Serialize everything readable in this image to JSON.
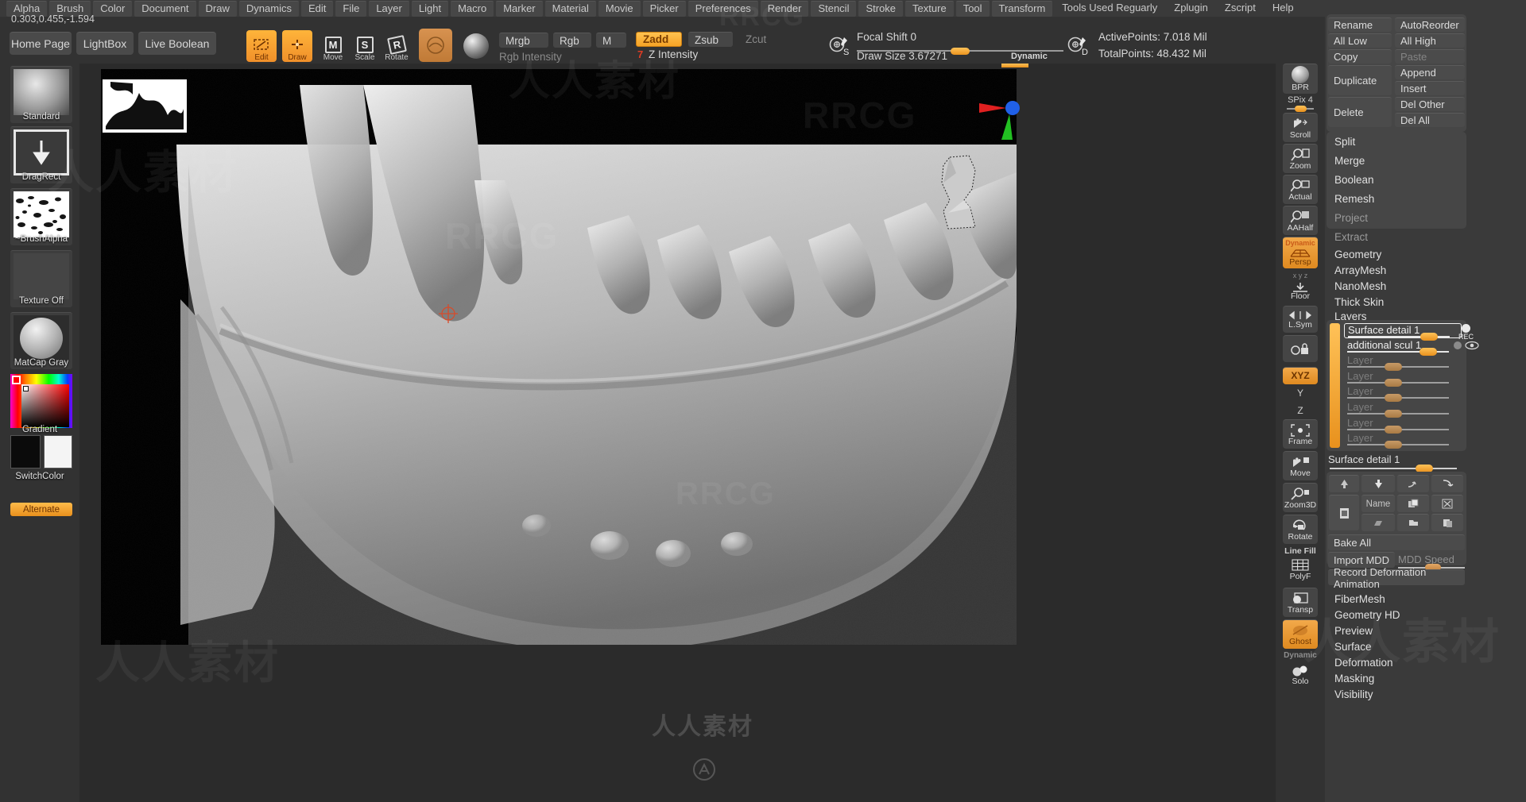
{
  "menu": {
    "items": [
      "Alpha",
      "Brush",
      "Color",
      "Document",
      "Draw",
      "Dynamics",
      "Edit",
      "File",
      "Layer",
      "Light",
      "Macro",
      "Marker",
      "Material",
      "Movie",
      "Picker",
      "Preferences",
      "Render",
      "Stencil",
      "Stroke",
      "Texture",
      "Tool",
      "Transform",
      "Tools Used Reguarly",
      "Zplugin",
      "Zscript",
      "Help"
    ]
  },
  "coord": "0.303,0.455,-1.594",
  "toolbar": {
    "home_page": "Home Page",
    "lightbox": "LightBox",
    "live_boolean": "Live Boolean",
    "edit": "Edit",
    "draw": "Draw",
    "move": "Move",
    "scale": "Scale",
    "rotate": "Rotate",
    "mrgb": "Mrgb",
    "rgb": "Rgb",
    "m": "M",
    "rgb_intensity": "Rgb Intensity",
    "zadd": "Zadd",
    "zsub": "Zsub",
    "zcut": "Zcut",
    "z_intensity": "Z Intensity",
    "z_intensity_value": "7",
    "focal_shift": "Focal Shift 0",
    "draw_size": "Draw Size 3.67271",
    "dynamic": "Dynamic",
    "active_points": "ActivePoints: 7.018 Mil",
    "total_points": "TotalPoints: 48.432 Mil",
    "s_badge": "S",
    "d_badge": "D"
  },
  "left_palette": {
    "brush": "Standard",
    "stroke": "DragRect",
    "alpha": "~BrushAlpha",
    "texture": "Texture Off",
    "material": "MatCap Gray",
    "gradient": "Gradient",
    "switch_color": "SwitchColor",
    "alternate": "Alternate"
  },
  "rail": {
    "bpr": "BPR",
    "spix": "SPix 4",
    "scroll": "Scroll",
    "zoom": "Zoom",
    "actual": "Actual",
    "aahalf": "AAHalf",
    "persp": "Persp",
    "persp_top": "Dynamic",
    "floor": "Floor",
    "lsym": "L.Sym",
    "local": "Local",
    "xyz": "XYZ",
    "y_axis": "Y",
    "z_axis": "Z",
    "frame": "Frame",
    "move": "Move",
    "zoom3d": "Zoom3D",
    "rotate": "Rotate",
    "line_fill": "Line Fill",
    "polyf": "PolyF",
    "transp": "Transp",
    "ghost": "Ghost",
    "dynamic": "Dynamic",
    "solo": "Solo"
  },
  "tool_panel": {
    "subtool_buttons": [
      {
        "label": "Rename",
        "disabled": false
      },
      {
        "label": "AutoReorder",
        "disabled": false
      },
      {
        "label": "All Low",
        "disabled": false
      },
      {
        "label": "All High",
        "disabled": false
      },
      {
        "label": "Copy",
        "disabled": false
      },
      {
        "label": "Paste",
        "disabled": true
      },
      {
        "label": "Duplicate",
        "disabled": false
      },
      {
        "label": "Append",
        "disabled": false
      },
      {
        "label": "Insert",
        "disabled": false
      },
      {
        "label": "Delete",
        "disabled": false
      },
      {
        "label": "Del Other",
        "disabled": false
      },
      {
        "label": "Del All",
        "disabled": false
      }
    ],
    "split": "Split",
    "merge": "Merge",
    "boolean": "Boolean",
    "remesh": "Remesh",
    "project": "Project",
    "extract": "Extract",
    "sections": [
      "Geometry",
      "ArrayMesh",
      "NanoMesh",
      "Thick Skin"
    ],
    "layers_title": "Layers",
    "layers": [
      {
        "name": "Surface detail",
        "num": "1",
        "intensity": 0.8,
        "active": true,
        "rec": "REC"
      },
      {
        "name": "additional scul",
        "num": "1",
        "intensity": 0.8,
        "active": false,
        "rec": ""
      },
      {
        "name": "Layer",
        "num": "",
        "intensity": 0.45,
        "active": false,
        "rec": ""
      },
      {
        "name": "Layer",
        "num": "",
        "intensity": 0.45,
        "active": false,
        "rec": ""
      },
      {
        "name": "Layer",
        "num": "",
        "intensity": 0.45,
        "active": false,
        "rec": ""
      },
      {
        "name": "Layer",
        "num": "",
        "intensity": 0.45,
        "active": false,
        "rec": ""
      },
      {
        "name": "Layer",
        "num": "",
        "intensity": 0.45,
        "active": false,
        "rec": ""
      },
      {
        "name": "Layer",
        "num": "",
        "intensity": 0.45,
        "active": false,
        "rec": ""
      }
    ],
    "selected_layer": "Surface detail 1",
    "name_button": "Name",
    "bake_all": "Bake All",
    "import_mdd": "Import MDD",
    "mdd_speed": "MDD Speed",
    "record_deformation": "Record Deformation Animation",
    "bottom_sections": [
      "FiberMesh",
      "Geometry HD",
      "Preview",
      "Surface",
      "Deformation",
      "Masking",
      "Visibility"
    ]
  },
  "watermarks": {
    "brand": "RRCG",
    "cn": "人人素材"
  }
}
